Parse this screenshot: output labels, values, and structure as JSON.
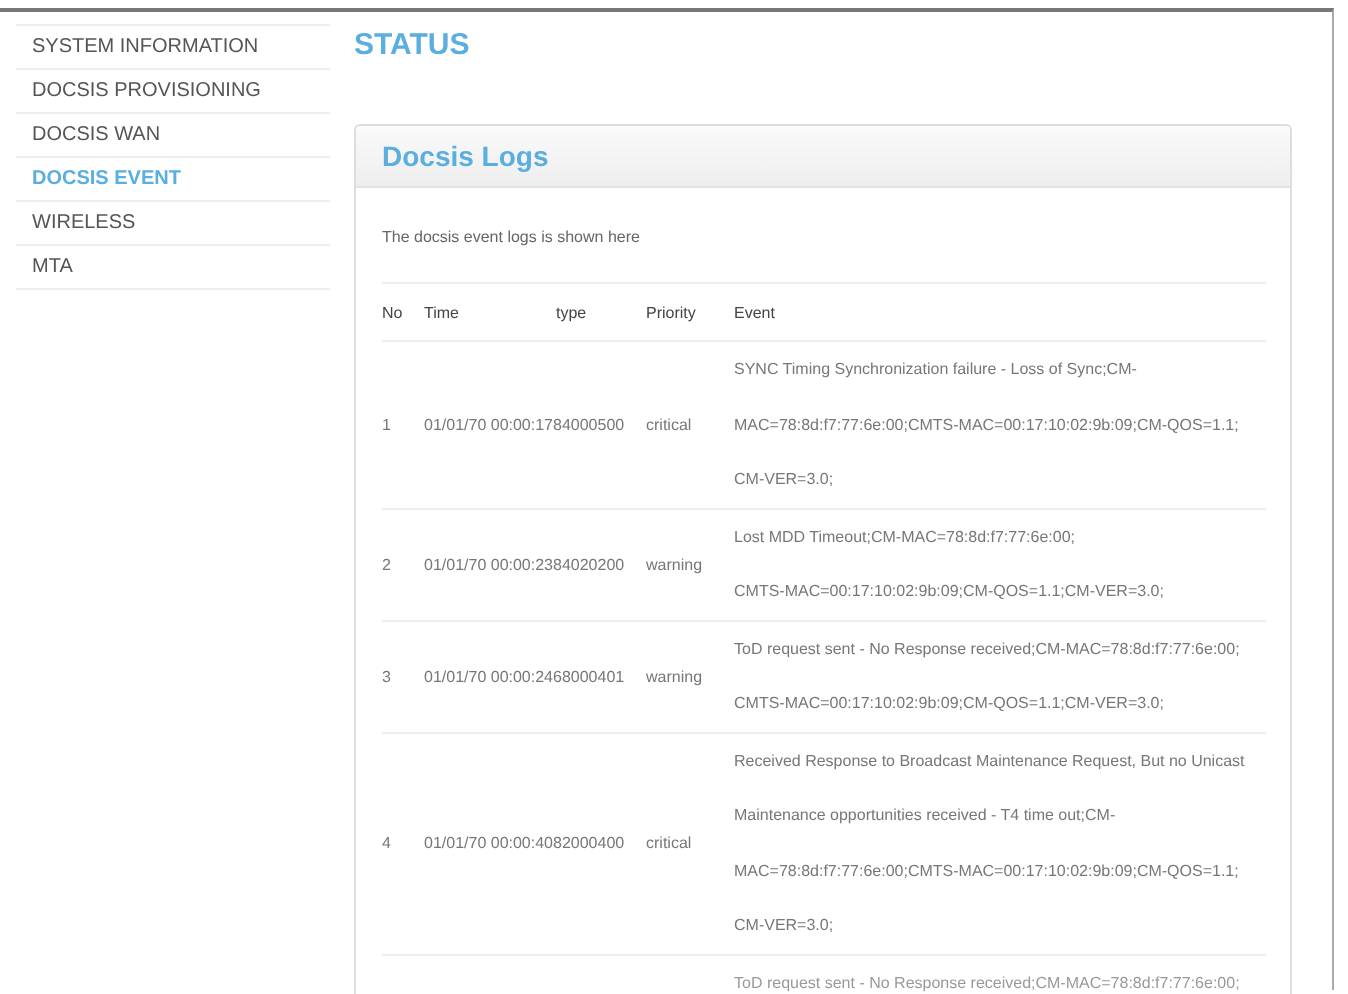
{
  "sidebar": {
    "items": [
      {
        "label": "SYSTEM INFORMATION",
        "selected": false
      },
      {
        "label": "DOCSIS PROVISIONING",
        "selected": false
      },
      {
        "label": "DOCSIS WAN",
        "selected": false
      },
      {
        "label": "DOCSIS EVENT",
        "selected": true
      },
      {
        "label": "WIRELESS",
        "selected": false
      },
      {
        "label": "MTA",
        "selected": false
      }
    ]
  },
  "page_title": "STATUS",
  "panel": {
    "title": "Docsis Logs",
    "description": "The docsis event logs is shown here",
    "table": {
      "columns": [
        "No",
        "Time",
        "type",
        "Priority",
        "Event"
      ],
      "rows": [
        {
          "kind": "full",
          "no": "1",
          "time": "01/01/70 00:00:1784000500",
          "type": "",
          "priority": "critical",
          "event": [
            "SYNC Timing Synchronization failure - Loss of Sync;CM-",
            "MAC=78:8d:f7:77:6e:00;CMTS-MAC=00:17:10:02:9b:09;CM-QOS=1.1;",
            "CM-VER=3.0;"
          ]
        },
        {
          "kind": "full",
          "no": "2",
          "time": "01/01/70 00:00:2384020200",
          "type": "",
          "priority": "warning",
          "event": [
            "Lost MDD Timeout;CM-MAC=78:8d:f7:77:6e:00;",
            "CMTS-MAC=00:17:10:02:9b:09;CM-QOS=1.1;CM-VER=3.0;"
          ]
        },
        {
          "kind": "full",
          "no": "3",
          "time": "01/01/70 00:00:2468000401",
          "type": "",
          "priority": "warning",
          "event": [
            "ToD request sent - No Response received;CM-MAC=78:8d:f7:77:6e:00;",
            "CMTS-MAC=00:17:10:02:9b:09;CM-QOS=1.1;CM-VER=3.0;"
          ]
        },
        {
          "kind": "full",
          "no": "4",
          "time": "01/01/70 00:00:4082000400",
          "type": "",
          "priority": "critical",
          "event": [
            "Received Response to Broadcast Maintenance Request, But no Unicast",
            "Maintenance opportunities received - T4 time out;CM-",
            "MAC=78:8d:f7:77:6e:00;CMTS-MAC=00:17:10:02:9b:09;CM-QOS=1.1;",
            "CM-VER=3.0;"
          ]
        },
        {
          "kind": "faded",
          "event": [
            "ToD request sent - No Response received;CM-MAC=78:8d:f7:77:6e:00;"
          ]
        }
      ]
    }
  }
}
